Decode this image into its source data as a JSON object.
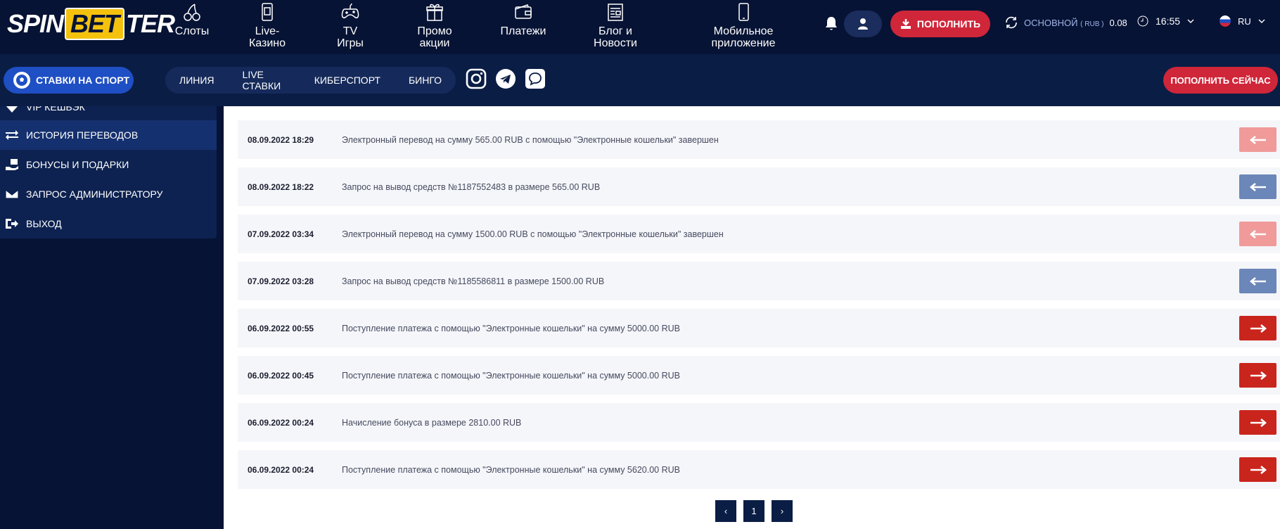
{
  "brand": {
    "left": "SPIN",
    "mid": "BET",
    "right": "TER"
  },
  "nav": [
    {
      "id": "slots",
      "label": "Слоты",
      "icon": "cherries-icon"
    },
    {
      "id": "live-casino",
      "label": "Live-Казино",
      "icon": "phone-cards-icon"
    },
    {
      "id": "tv-games",
      "label": "TV Игры",
      "icon": "gamepad-icon"
    },
    {
      "id": "promo",
      "label": "Промо акции",
      "icon": "gift-icon"
    },
    {
      "id": "payments",
      "label": "Платежи",
      "icon": "wallet-icon"
    },
    {
      "id": "blog",
      "label": "Блог и Новости",
      "icon": "newspaper-icon"
    },
    {
      "id": "mobile",
      "label": "Мобильное приложение",
      "icon": "smartphone-icon"
    }
  ],
  "header": {
    "deposit_label": "ПОПОЛНИТЬ",
    "balance_label": "ОСНОВНОЙ",
    "balance_currency": "( RUB )",
    "balance_value": "0.08",
    "time": "16:55",
    "lang": "RU"
  },
  "subbar": {
    "sport_label": "СТАВКИ НА СПОРТ",
    "links": [
      "ЛИНИЯ",
      "LIVE СТАВКИ",
      "КИБЕРСПОРТ",
      "БИНГО"
    ],
    "deposit_now_label": "ПОПОЛНИТЬ СЕЙЧАС"
  },
  "sidebar": {
    "items": [
      {
        "label": "VIP КЕШБЭК",
        "icon": "diamond-icon",
        "active": false
      },
      {
        "label": "ИСТОРИЯ ПЕРЕВОДОВ",
        "icon": "transfer-arrows-icon",
        "active": true
      },
      {
        "label": "БОНУСЫ И ПОДАРКИ",
        "icon": "gift-hand-icon",
        "active": false
      },
      {
        "label": "ЗАПРОС АДМИНИСТРАТОРУ",
        "icon": "envelope-icon",
        "active": false
      },
      {
        "label": "ВЫХОД",
        "icon": "logout-icon",
        "active": false
      }
    ]
  },
  "transactions": [
    {
      "date": "08.09.2022 18:29",
      "text": "Электронный перевод на сумму 565.00 RUB с помощью \"Электронные кошельки\" завершен",
      "type": "out-complete",
      "color": "#f09a9a"
    },
    {
      "date": "08.09.2022 18:22",
      "text": "Запрос на вывод средств №1187552483 в размере 565.00 RUB",
      "type": "out-request",
      "color": "#6b86b8"
    },
    {
      "date": "07.09.2022 03:34",
      "text": "Электронный перевод на сумму 1500.00 RUB с помощью \"Электронные кошельки\" завершен",
      "type": "out-complete",
      "color": "#f09a9a"
    },
    {
      "date": "07.09.2022 03:28",
      "text": "Запрос на вывод средств №1185586811 в размере 1500.00 RUB",
      "type": "out-request",
      "color": "#6b86b8"
    },
    {
      "date": "06.09.2022 00:55",
      "text": "Поступление платежа с помощью \"Электронные кошельки\" на сумму 5000.00 RUB",
      "type": "in",
      "color": "#c9251d"
    },
    {
      "date": "06.09.2022 00:45",
      "text": "Поступление платежа с помощью \"Электронные кошельки\" на сумму 5000.00 RUB",
      "type": "in",
      "color": "#c9251d"
    },
    {
      "date": "06.09.2022 00:24",
      "text": "Начисление бонуса в размере 2810.00 RUB",
      "type": "in",
      "color": "#c9251d"
    },
    {
      "date": "06.09.2022 00:24",
      "text": "Поступление платежа с помощью \"Электронные кошельки\" на сумму 5620.00 RUB",
      "type": "in",
      "color": "#c9251d"
    }
  ],
  "pagination": {
    "prev": "‹",
    "current": "1",
    "next": "›"
  }
}
